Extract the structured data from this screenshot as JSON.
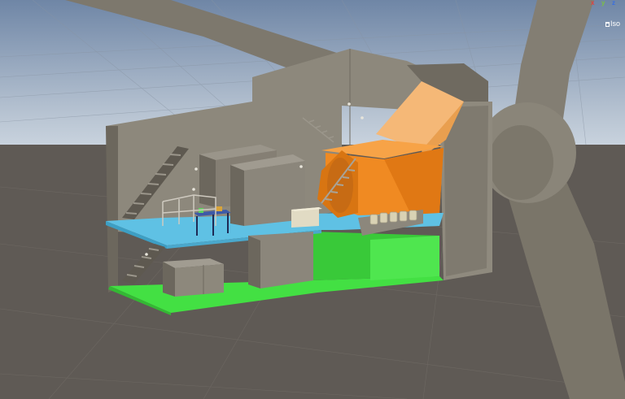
{
  "scene_view": {
    "projection_label": "Iso",
    "gizmo_axes": {
      "x": "x",
      "y": "y",
      "z": "z"
    }
  },
  "colors": {
    "sky_top": "#6f86a6",
    "sky_bottom": "#c9d3de",
    "ground": "#5f5a55",
    "blade": "#7d786d",
    "wall": "#8d887c",
    "orange": "#f08a22",
    "blue_floor": "#5fc1e4",
    "green_floor": "#43e043"
  }
}
